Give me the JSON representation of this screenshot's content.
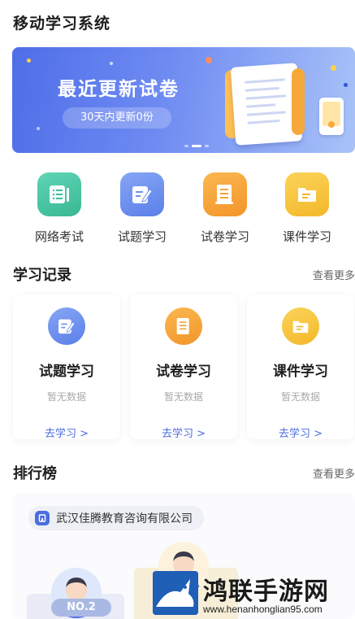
{
  "app": {
    "title": "移动学习系统"
  },
  "banner": {
    "title": "最近更新试卷",
    "subtitle": "30天内更新0份",
    "gradient_start": "#4f6ee8",
    "gradient_end": "#a9c3f8",
    "carousel": {
      "count": 3,
      "active_index": 1
    }
  },
  "quick_nav": [
    {
      "label": "网络考试",
      "icon": "exam-list-icon",
      "color": "#49c6a6"
    },
    {
      "label": "试题学习",
      "icon": "question-edit-icon",
      "color": "#6f93ef"
    },
    {
      "label": "试卷学习",
      "icon": "paper-icon",
      "color": "#f6a43a"
    },
    {
      "label": "课件学习",
      "icon": "courseware-icon",
      "color": "#f7c63f"
    }
  ],
  "records": {
    "title": "学习记录",
    "more": "查看更多",
    "cards": [
      {
        "title": "试题学习",
        "empty": "暂无数据",
        "link": "去学习 >",
        "icon": "question-edit-icon",
        "color": "#6f93ef"
      },
      {
        "title": "试卷学习",
        "empty": "暂无数据",
        "link": "去学习 >",
        "icon": "paper-icon",
        "color": "#f6a43a"
      },
      {
        "title": "课件学习",
        "empty": "暂无数据",
        "link": "去学习 >",
        "icon": "courseware-icon",
        "color": "#f7c63f"
      }
    ]
  },
  "ranking": {
    "title": "排行榜",
    "more": "查看更多",
    "organization": "武汉佳腾教育咨询有限公司",
    "second_place_badge": "NO.2"
  },
  "watermark": {
    "name": "鸿联手游网",
    "url": "www.henanhonglian95.com"
  },
  "colors": {
    "accent": "#4b6de0",
    "text_primary": "#1e1e1e",
    "text_muted": "#aaaaaa"
  }
}
